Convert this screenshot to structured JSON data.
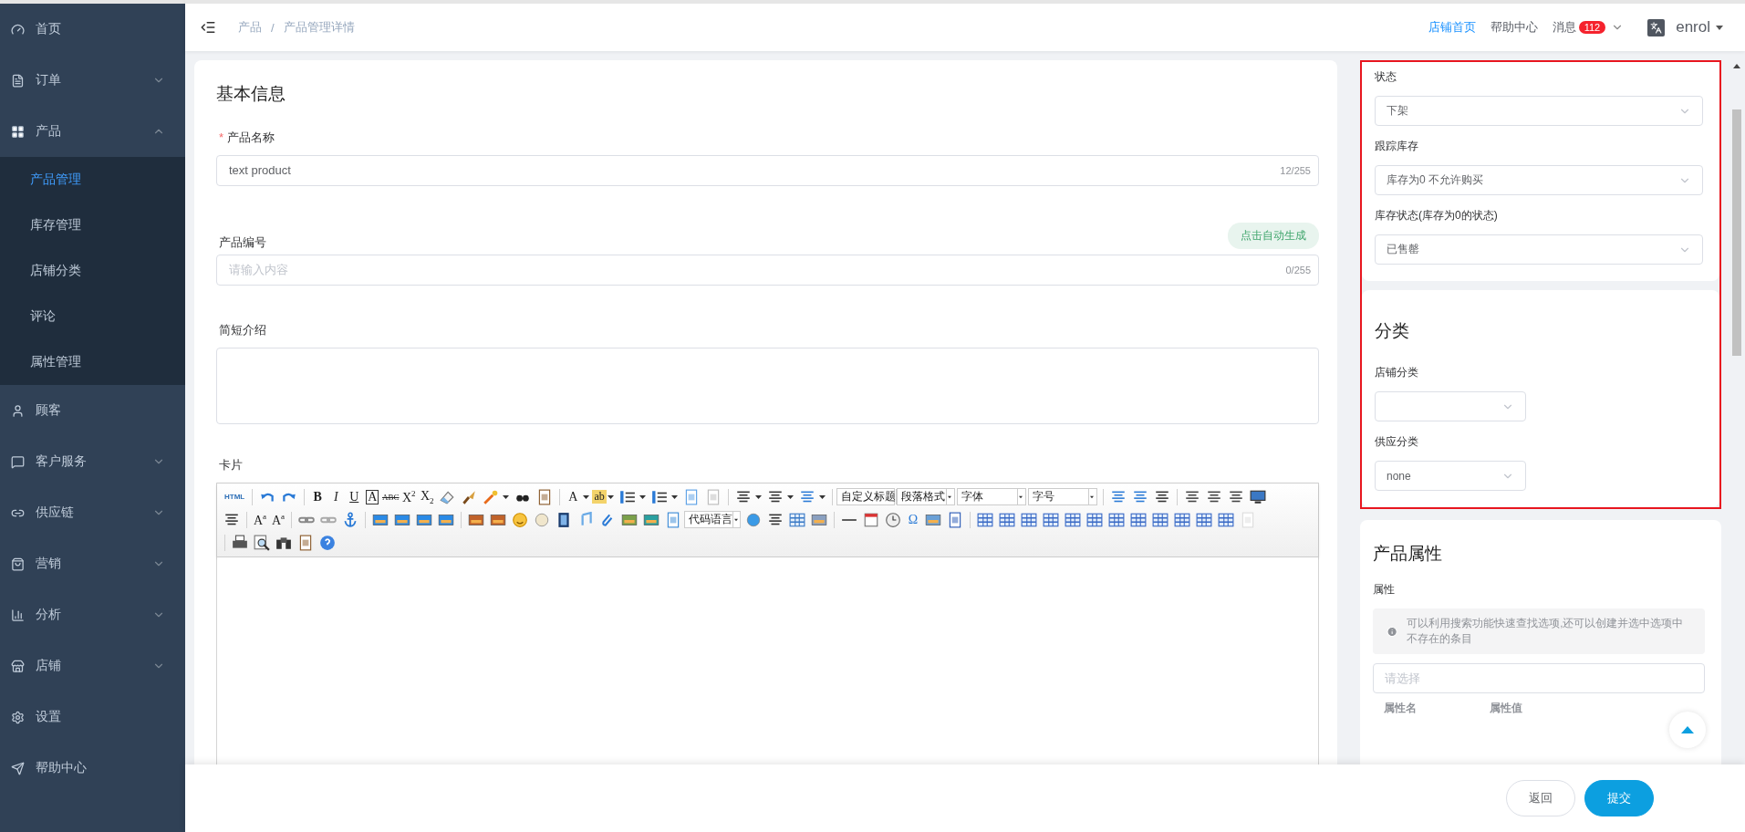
{
  "sidebar": {
    "items": [
      {
        "label": "首页",
        "selected": false
      },
      {
        "label": "订单",
        "selected": false,
        "expanded": false
      },
      {
        "label": "产品",
        "selected": false,
        "expanded": true,
        "children": [
          {
            "label": "产品管理",
            "selected": true
          },
          {
            "label": "库存管理",
            "selected": false
          },
          {
            "label": "店铺分类",
            "selected": false
          },
          {
            "label": "评论",
            "selected": false
          },
          {
            "label": "属性管理",
            "selected": false
          }
        ]
      },
      {
        "label": "顾客",
        "selected": false
      },
      {
        "label": "客户服务",
        "selected": false,
        "expanded": false
      },
      {
        "label": "供应链",
        "selected": false,
        "expanded": false
      },
      {
        "label": "营销",
        "selected": false,
        "expanded": false
      },
      {
        "label": "分析",
        "selected": false,
        "expanded": false
      },
      {
        "label": "店铺",
        "selected": false,
        "expanded": false
      },
      {
        "label": "设置",
        "selected": false
      },
      {
        "label": "帮助中心",
        "selected": false
      }
    ]
  },
  "topbar": {
    "breadcrumb": [
      "产品",
      "产品管理详情"
    ],
    "breadcrumb_separator": "/",
    "links": [
      {
        "label": "店铺首页",
        "selected": true
      },
      {
        "label": "帮助中心",
        "selected": false
      }
    ],
    "messages": {
      "label": "消息",
      "badge": "112"
    },
    "user": "enrol"
  },
  "basic_info": {
    "title": "基本信息",
    "name_field": {
      "required_mark": "*",
      "label": "产品名称",
      "value": "text product",
      "counter": "12/255"
    },
    "code_field": {
      "label": "产品编号",
      "action": "点击自动生成",
      "placeholder": "请输入内容",
      "counter": "0/255"
    },
    "summary_field": {
      "label": "简短介绍"
    },
    "card_label": "卡片",
    "toolbar_rows": [
      [
        {
          "kind": "text",
          "label": "HTML"
        },
        {
          "kind": "sep"
        },
        {
          "kind": "icon"
        },
        {
          "kind": "icon"
        },
        {
          "kind": "sep"
        },
        {
          "kind": "glyph",
          "label": "B"
        },
        {
          "kind": "glyph",
          "label": "I"
        },
        {
          "kind": "glyph",
          "label": "U"
        },
        {
          "kind": "glyph",
          "label": "A"
        },
        {
          "kind": "glyph",
          "label": "ABC"
        },
        {
          "kind": "glyph",
          "label": "X$^{2}$"
        },
        {
          "kind": "glyph",
          "label": "X$_{2}$"
        },
        {
          "kind": "icon"
        },
        {
          "kind": "icon"
        },
        {
          "kind": "icon-dropdown"
        },
        {
          "kind": "icon"
        },
        {
          "kind": "icon"
        },
        {
          "kind": "sep"
        },
        {
          "kind": "glyph-dropdown",
          "label": "A"
        },
        {
          "kind": "glyph-dropdown",
          "label": "ab"
        },
        {
          "kind": "icon-dropdown"
        },
        {
          "kind": "icon-dropdown"
        },
        {
          "kind": "icon"
        },
        {
          "kind": "icon"
        },
        {
          "kind": "sep"
        },
        {
          "kind": "icon-dropdown"
        },
        {
          "kind": "icon-dropdown"
        },
        {
          "kind": "icon-dropdown"
        },
        {
          "kind": "sep"
        },
        {
          "kind": "select",
          "label": "自定义标题"
        },
        {
          "kind": "select",
          "label": "段落格式"
        },
        {
          "kind": "select",
          "label": "字体"
        },
        {
          "kind": "select",
          "label": "字号"
        },
        {
          "kind": "sep"
        },
        {
          "kind": "icon"
        },
        {
          "kind": "icon"
        },
        {
          "kind": "icon"
        },
        {
          "kind": "sep"
        },
        {
          "kind": "icon"
        },
        {
          "kind": "icon"
        },
        {
          "kind": "icon"
        },
        {
          "kind": "icon"
        }
      ],
      [
        {
          "kind": "icon"
        },
        {
          "kind": "sep"
        },
        {
          "kind": "glyph",
          "label": "A$^{a}$"
        },
        {
          "kind": "glyph",
          "label": "A$^{a}$"
        },
        {
          "kind": "sep"
        },
        {
          "kind": "icon"
        },
        {
          "kind": "icon"
        },
        {
          "kind": "icon"
        },
        {
          "kind": "sep"
        },
        {
          "kind": "icon"
        },
        {
          "kind": "icon"
        },
        {
          "kind": "icon"
        },
        {
          "kind": "icon"
        },
        {
          "kind": "sep"
        },
        {
          "kind": "icon"
        },
        {
          "kind": "icon"
        },
        {
          "kind": "icon"
        },
        {
          "kind": "icon"
        },
        {
          "kind": "icon"
        },
        {
          "kind": "icon"
        },
        {
          "kind": "icon"
        },
        {
          "kind": "icon"
        },
        {
          "kind": "icon"
        },
        {
          "kind": "icon"
        },
        {
          "kind": "select",
          "label": "代码语言"
        },
        {
          "kind": "icon"
        },
        {
          "kind": "icon"
        },
        {
          "kind": "icon"
        },
        {
          "kind": "icon"
        },
        {
          "kind": "sep"
        },
        {
          "kind": "icon"
        },
        {
          "kind": "icon"
        },
        {
          "kind": "icon"
        },
        {
          "kind": "glyph",
          "label": "Ω"
        },
        {
          "kind": "icon"
        },
        {
          "kind": "icon"
        },
        {
          "kind": "sep"
        },
        {
          "kind": "icon"
        },
        {
          "kind": "icon"
        },
        {
          "kind": "icon"
        },
        {
          "kind": "icon"
        },
        {
          "kind": "icon"
        },
        {
          "kind": "icon"
        },
        {
          "kind": "icon"
        },
        {
          "kind": "icon"
        },
        {
          "kind": "icon"
        },
        {
          "kind": "icon"
        },
        {
          "kind": "icon"
        },
        {
          "kind": "icon"
        },
        {
          "kind": "icon"
        }
      ],
      [
        {
          "kind": "sep"
        },
        {
          "kind": "icon"
        },
        {
          "kind": "icon"
        },
        {
          "kind": "icon"
        },
        {
          "kind": "icon"
        },
        {
          "kind": "icon"
        }
      ]
    ]
  },
  "right_panel": {
    "highlighted": true,
    "status_card": {
      "fields": [
        {
          "label": "状态",
          "value": "下架"
        },
        {
          "label": "跟踪库存",
          "value": "库存为0 不允许购买"
        },
        {
          "label": "库存状态(库存为0的状态)",
          "value": "已售罄"
        }
      ]
    },
    "category_card": {
      "title": "分类",
      "fields": [
        {
          "label": "店铺分类"
        },
        {
          "label": "供应分类",
          "value": "none"
        }
      ]
    },
    "attribute_card": {
      "title": "产品属性",
      "label": "属性",
      "notice": "可以利用搜索功能快速查找选项,还可以创建并选中选项中不存在的条目",
      "placeholder": "请选择",
      "columns": [
        "属性名",
        "属性值"
      ]
    }
  },
  "footer": {
    "buttons": [
      {
        "label": "返回",
        "kind": "default"
      },
      {
        "label": "提交",
        "kind": "primary"
      }
    ]
  }
}
